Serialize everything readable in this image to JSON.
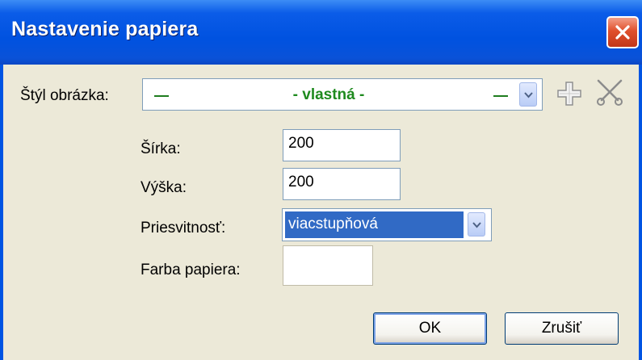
{
  "window": {
    "title": "Nastavenie papiera"
  },
  "style_row": {
    "label": "Štýl obrázka:",
    "value": "- vlastná -"
  },
  "width": {
    "label": "Šírka:",
    "value": "200"
  },
  "height": {
    "label": "Výška:",
    "value": "200"
  },
  "transparency": {
    "label": "Priesvitnosť:",
    "value": "viacstupňová"
  },
  "paper_color": {
    "label": "Farba papiera:",
    "value": "#ffffff"
  },
  "buttons": {
    "ok": "OK",
    "cancel": "Zrušiť"
  },
  "colors": {
    "titlebar": "#0054e3",
    "dialog_bg": "#ece9d8",
    "style_value": "#1e8a1e",
    "selection": "#316ac5",
    "close": "#e0502c"
  },
  "icons": {
    "close": "close-icon",
    "dropdown": "chevron-down-icon",
    "add": "plus-icon",
    "delete": "scissors-icon"
  }
}
